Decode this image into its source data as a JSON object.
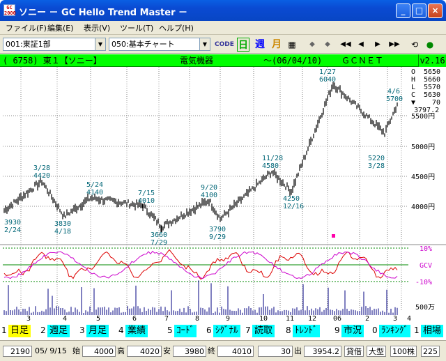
{
  "window": {
    "app_icon_top": "GC",
    "app_icon_bottom": "2000",
    "title": "ソニー － GC Hello Trend Master －",
    "min": "_",
    "max": "□",
    "close": "×"
  },
  "menu": [
    "ファイル(F)",
    "編集(E)",
    "表示(V)",
    "ツール(T)",
    "ヘルプ(H)"
  ],
  "toolbar": {
    "market": "001:東証1部",
    "chart_type": "050:基本チャート",
    "code_btn": "CODE",
    "daily": "日",
    "weekly": "週",
    "monthly": "月",
    "nav": [
      "◆",
      "◆",
      "◀◀",
      "◀",
      "▶",
      "▶▶"
    ]
  },
  "info": {
    "code": "( 6758) 東１【ソニー】",
    "sector": "電気機器",
    "date": "～(06/04/10)",
    "source": "ＧＣＮＥＴ",
    "version": "v2.16"
  },
  "ohlc": {
    "O": "5650",
    "H": "5660",
    "L": "5570",
    "C": "5630",
    "change_symbol": "▼",
    "change": "70",
    "avg": "3797.2"
  },
  "price_axis": [
    "5500円",
    "5000円",
    "4500円",
    "4000円"
  ],
  "osc_axis": {
    "upper": "10%",
    "mid": "GCV",
    "lower": "-10%"
  },
  "volume_axis": "500万",
  "month_labels": [
    "3",
    "4",
    "5",
    "6",
    "7",
    "8",
    "9",
    "10",
    "11",
    "12",
    "06",
    "2",
    "3",
    "4"
  ],
  "annotations": [
    {
      "text": "3930"
    },
    {
      "text": "2/24"
    },
    {
      "text": "3/28"
    },
    {
      "text": "4420"
    },
    {
      "text": "3830"
    },
    {
      "text": "4/18"
    },
    {
      "text": "5/24"
    },
    {
      "text": "4140"
    },
    {
      "text": "7/15"
    },
    {
      "text": "4010"
    },
    {
      "text": "3660"
    },
    {
      "text": "7/29"
    },
    {
      "text": "9/20"
    },
    {
      "text": "4100"
    },
    {
      "text": "3790"
    },
    {
      "text": "9/29"
    },
    {
      "text": "11/28"
    },
    {
      "text": "4580"
    },
    {
      "text": "4250"
    },
    {
      "text": "12/16"
    },
    {
      "text": "1/27"
    },
    {
      "text": "6040"
    },
    {
      "text": "5220"
    },
    {
      "text": "3/28"
    },
    {
      "text": "4/6"
    },
    {
      "text": "5700"
    }
  ],
  "chart_data": {
    "type": "candlestick",
    "price_range": [
      3600,
      6100
    ],
    "key_points": [
      {
        "date": "2/24",
        "price": 3930
      },
      {
        "date": "3/28",
        "price": 4420
      },
      {
        "date": "4/18",
        "price": 3830
      },
      {
        "date": "5/24",
        "price": 4140
      },
      {
        "date": "7/15",
        "price": 4010
      },
      {
        "date": "7/29",
        "price": 3660
      },
      {
        "date": "9/20",
        "price": 4100
      },
      {
        "date": "9/29",
        "price": 3790
      },
      {
        "date": "11/28",
        "price": 4580
      },
      {
        "date": "12/16",
        "price": 4250
      },
      {
        "date": "1/27",
        "price": 6040
      },
      {
        "date": "3/28",
        "price": 5220
      },
      {
        "date": "4/6",
        "price": 5700
      }
    ],
    "colors": {
      "price": "#000000",
      "osc_red": "#dd0000",
      "osc_magenta": "#cc00cc",
      "osc_ref": "#008800",
      "volume": "#000080"
    }
  },
  "tabs": [
    {
      "num": "1",
      "label": "日足",
      "active": true
    },
    {
      "num": "2",
      "label": "週足"
    },
    {
      "num": "3",
      "label": "月足"
    },
    {
      "num": "4",
      "label": "業績"
    },
    {
      "num": "5",
      "label": "ｺｰﾄﾞ"
    },
    {
      "num": "6",
      "label": "ｼｸﾞﾅﾙ"
    },
    {
      "num": "7",
      "label": "読取"
    },
    {
      "num": "8",
      "label": "ﾄﾚﾝﾄﾞ"
    },
    {
      "num": "9",
      "label": "市況"
    },
    {
      "num": "0",
      "label": "ﾗﾝｷﾝｸﾞ"
    },
    {
      "num": "1",
      "label": "相場"
    }
  ],
  "status": {
    "count": "2190",
    "date": "05/ 9/15",
    "open_lbl": "始",
    "open": "4000",
    "high_lbl": "高",
    "high": "4020",
    "low_lbl": "安",
    "low": "3980",
    "close_lbl": "終",
    "close": "4010",
    "volume": "30",
    "out_lbl": "出",
    "avg": "3954.2",
    "lending": "貸借",
    "size": "大型",
    "unit": "100株",
    "last": "225"
  }
}
